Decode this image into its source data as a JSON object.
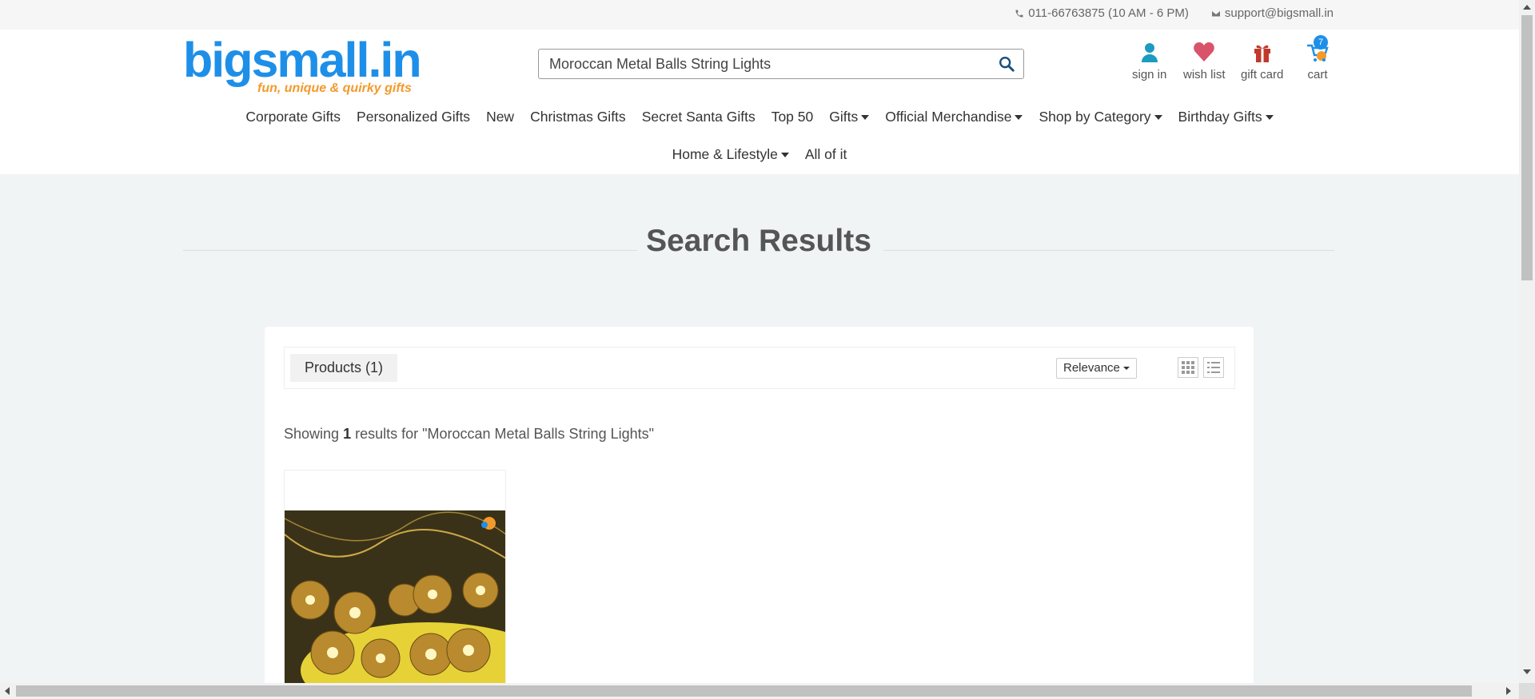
{
  "topbar": {
    "phone": "011-66763875 (10 AM - 6 PM)",
    "email": "support@bigsmall.in"
  },
  "logo": {
    "name": "bigsmall.in",
    "tagline": "fun, unique & quirky gifts"
  },
  "search": {
    "value": "Moroccan Metal Balls String Lights",
    "icon": "search-icon"
  },
  "account": {
    "signin_label": "sign in",
    "wishlist_label": "wish list",
    "giftcard_label": "gift card",
    "cart_label": "cart",
    "cart_count": "7"
  },
  "nav": {
    "row1": [
      {
        "label": "Corporate Gifts",
        "dropdown": false
      },
      {
        "label": "Personalized Gifts",
        "dropdown": false
      },
      {
        "label": "New",
        "dropdown": false
      },
      {
        "label": "Christmas Gifts",
        "dropdown": false
      },
      {
        "label": "Secret Santa Gifts",
        "dropdown": false
      },
      {
        "label": "Top 50",
        "dropdown": false
      },
      {
        "label": "Gifts",
        "dropdown": true
      },
      {
        "label": "Official Merchandise",
        "dropdown": true
      },
      {
        "label": "Shop by Category",
        "dropdown": true
      },
      {
        "label": "Birthday Gifts",
        "dropdown": true
      }
    ],
    "row2": [
      {
        "label": "Home & Lifestyle",
        "dropdown": true
      },
      {
        "label": "All of it",
        "dropdown": false
      }
    ]
  },
  "page": {
    "title": "Search Results"
  },
  "toolbar": {
    "products_tab": "Products (1)",
    "sort_value": "Relevance"
  },
  "results": {
    "prefix": "Showing ",
    "count": "1",
    "suffix": " results for \"Moroccan Metal Balls String Lights\""
  },
  "colors": {
    "brand_blue": "#1e8fe8",
    "brand_orange": "#f39a2b",
    "heart": "#d9536a",
    "gift": "#c0392b"
  }
}
